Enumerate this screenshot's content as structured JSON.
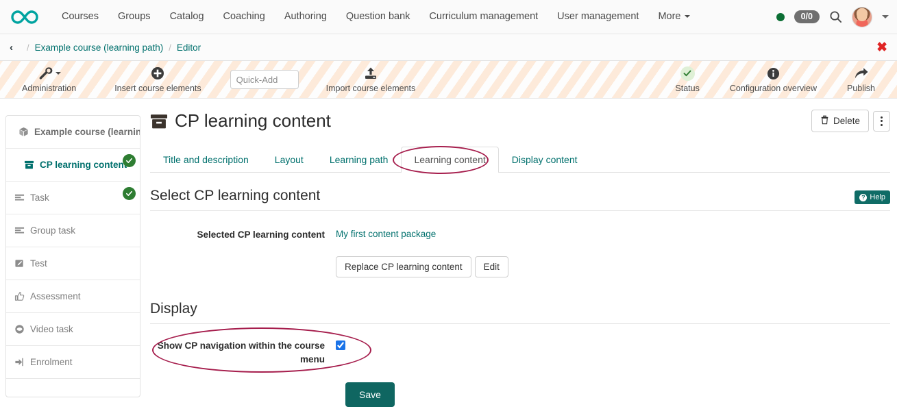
{
  "topnav": {
    "logo_name": "infinity-logo",
    "links": [
      {
        "label": "Courses"
      },
      {
        "label": "Groups"
      },
      {
        "label": "Catalog"
      },
      {
        "label": "Coaching"
      },
      {
        "label": "Authoring"
      },
      {
        "label": "Question bank"
      },
      {
        "label": "Curriculum management"
      },
      {
        "label": "User management"
      },
      {
        "label": "More"
      }
    ],
    "ratio_badge": "0/0",
    "search_icon": "search-icon",
    "status_dot": "online-status-dot",
    "avatar": "user-avatar"
  },
  "breadcrumb": {
    "back": "‹",
    "separator": "/",
    "items": [
      {
        "label": "Example course (learning path)"
      },
      {
        "label": "Editor"
      }
    ],
    "close": "✖"
  },
  "toolbar": {
    "items": [
      {
        "label": "Administration",
        "icon": "wrench-icon"
      },
      {
        "label": "Insert course elements",
        "icon": "plus-circle-icon"
      },
      {
        "label": "Import course elements",
        "icon": "upload-icon"
      }
    ],
    "quickadd_placeholder": "Quick-Add",
    "quickadd_value": "",
    "right_items": [
      {
        "label": "Status",
        "icon": "check-icon"
      },
      {
        "label": "Configuration overview",
        "icon": "info-icon"
      },
      {
        "label": "Publish",
        "icon": "share-arrow-icon"
      }
    ]
  },
  "sidebar": {
    "root": {
      "label": "Example course (learning",
      "icon": "package-icon"
    },
    "items": [
      {
        "label": "CP learning content",
        "icon": "archive-icon",
        "active": true,
        "badge": true
      },
      {
        "label": "Task",
        "icon": "lines-icon",
        "active": false,
        "badge": true
      },
      {
        "label": "Group task",
        "icon": "lines-icon",
        "active": false,
        "badge": false
      },
      {
        "label": "Test",
        "icon": "pencil-square-icon",
        "active": false,
        "badge": false
      },
      {
        "label": "Assessment",
        "icon": "thumbs-up-icon",
        "active": false,
        "badge": false
      },
      {
        "label": "Video task",
        "icon": "video-circle-icon",
        "active": false,
        "badge": false
      },
      {
        "label": "Enrolment",
        "icon": "sign-in-icon",
        "active": false,
        "badge": false
      }
    ]
  },
  "main": {
    "title": "CP learning content",
    "title_icon": "archive-icon",
    "delete_label": "Delete",
    "delete_icon": "trash-icon",
    "kebab_icon": "more-vertical-icon",
    "tabs": [
      {
        "label": "Title and description",
        "active": false
      },
      {
        "label": "Layout",
        "active": false
      },
      {
        "label": "Learning path",
        "active": false
      },
      {
        "label": "Learning content",
        "active": true
      },
      {
        "label": "Display content",
        "active": false
      }
    ],
    "section_select": {
      "heading": "Select CP learning content",
      "help_label": "Help",
      "help_icon": "question-circle-icon",
      "field_label": "Selected CP learning content",
      "field_value": "My first content package",
      "replace_button": "Replace CP learning content",
      "edit_button": "Edit"
    },
    "section_display": {
      "heading": "Display",
      "checkbox_label": "Show CP navigation within the course menu",
      "checkbox_checked": true,
      "save_label": "Save"
    }
  },
  "colors": {
    "brand_teal": "#00706d",
    "save_teal": "#0f6661",
    "annotation_red": "#a61e4d",
    "badge_green": "#2e7d32",
    "close_red": "#e02424",
    "stripe_peach": "#fdeada"
  }
}
